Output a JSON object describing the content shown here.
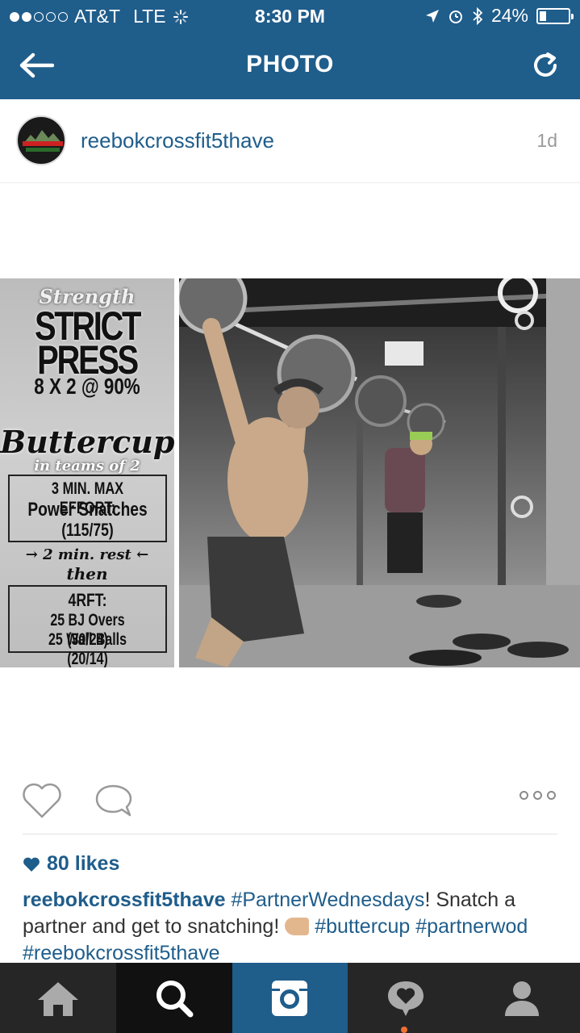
{
  "status_bar": {
    "carrier": "AT&T",
    "network": "LTE",
    "signal_bars_filled": 2,
    "signal_bars_total": 5,
    "time": "8:30 PM",
    "battery_percent": "24%",
    "battery_level": 0.24
  },
  "nav": {
    "title": "PHOTO",
    "back_icon": "back-arrow-icon",
    "refresh_icon": "refresh-icon"
  },
  "post": {
    "username": "reebokcrossfit5thave",
    "time_ago": "1d",
    "avatar_text": [
      "Reebok",
      "CrossFit"
    ],
    "image": {
      "left_panel": {
        "strength_label": "Strength",
        "title_line1": "STRICT",
        "title_line2": "PRESS",
        "scheme": "8 X 2 @ 90%",
        "wod_name": "Buttercup",
        "team_note": "in teams of 2",
        "box1_line1": "3 MIN. MAX EFFORT:",
        "box1_line2": "Power Snatches",
        "box1_line3": "(115/75)",
        "rest_note": "→ 2 min. rest ←",
        "then_note": "then",
        "box2_line1": "4RFT:",
        "box2_line2": "25 BJ Overs (30/24)",
        "box2_line3": "25 Wall Balls (20/14)"
      },
      "right_panel_description": "barbell-overhead-photo"
    },
    "likes": "80 likes",
    "caption": {
      "user": "reebokcrossfit5thave",
      "tag1": "#PartnerWednesdays",
      "text1": "! Snatch a partner and get to snatching! ",
      "tag2": "#buttercup",
      "tag3": "#partnerwod",
      "tag4": "#reebokcrossfit5thave"
    }
  },
  "tabbar": {
    "items": [
      "home-icon",
      "search-icon",
      "camera-icon",
      "activity-icon",
      "profile-icon"
    ],
    "active_index": 2
  },
  "colors": {
    "brand_blue": "#1f5d8b",
    "tab_bar": "#262626",
    "notification": "#f07030"
  }
}
